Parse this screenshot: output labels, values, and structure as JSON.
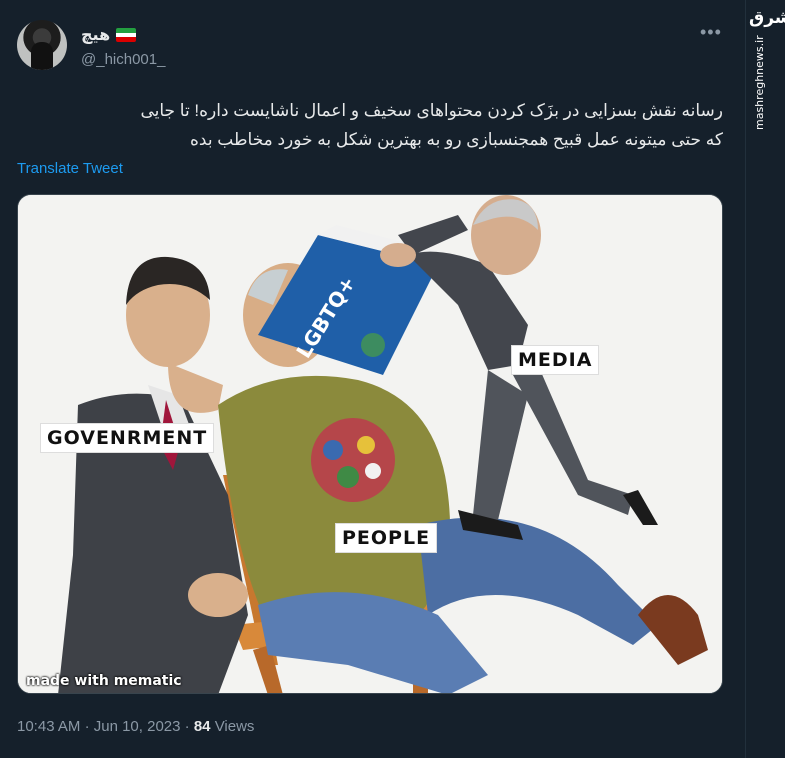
{
  "author": {
    "display_name": "هیچ",
    "handle": "@_hich001_",
    "flag": {
      "green": "#239f40",
      "white": "#ffffff",
      "red": "#da0000"
    }
  },
  "more_icon": "more-dots-icon",
  "tweet": {
    "text_line1": "رسانه نقش بسزایی در بزَک کردن محتواهای سخیف و اعمال ناشایست داره! تا جایی",
    "text_line2": "که حتی میتونه عمل قبیح همجنسبازی رو به بهترین شکل به خورد مخاطب بده",
    "translate_label": "Translate Tweet"
  },
  "image": {
    "labels": {
      "government": "GOVENRMENT",
      "media": "MEDIA",
      "people": "PEOPLE",
      "book": "LGBTQ+"
    },
    "watermark": "made with mematic"
  },
  "meta": {
    "time": "10:43 AM",
    "date": "Jun 10, 2023",
    "views_count": "84",
    "views_label": "Views"
  },
  "side": {
    "logo": "مشرق",
    "url": "mashreghnews.ir"
  },
  "colors": {
    "background": "#15202b",
    "link": "#1d9bf0",
    "secondary": "#8b98a5"
  }
}
